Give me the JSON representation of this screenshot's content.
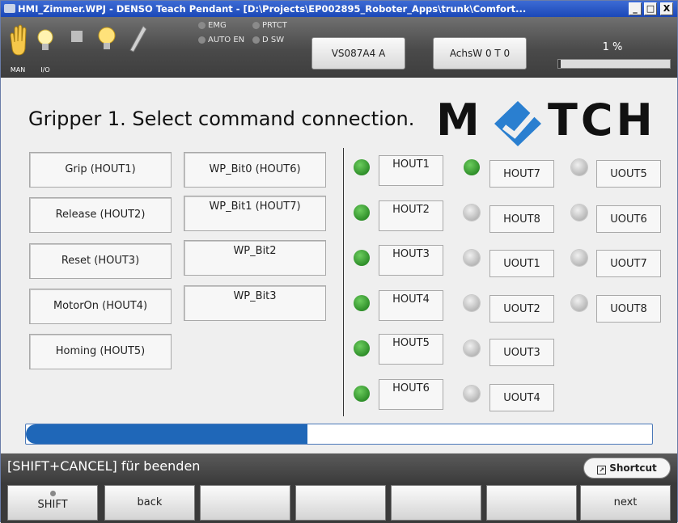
{
  "window": {
    "title": "HMI_Zimmer.WPJ - DENSO Teach Pendant - [D:\\Projects\\EP002895_Roboter_Apps\\trunk\\Comfort...",
    "min": "_",
    "max": "□",
    "close": "X"
  },
  "toolbar": {
    "mode_label": "MAN",
    "io_label": "I/O",
    "leds": {
      "emg": "EMG",
      "prtct": "PRTCT",
      "auto_en": "AUTO EN",
      "dsw": "D SW"
    },
    "field1": "VS087A4 A",
    "field2": "AchsW 0 T 0",
    "speed_text": "1 %",
    "speed_level": 0.01
  },
  "main": {
    "heading": "Gripper 1. Select command connection.",
    "logo_left": "M",
    "logo_right": "TCH",
    "commands": [
      "Grip (HOUT1)",
      "Release (HOUT2)",
      "Reset (HOUT3)",
      "MotorOn (HOUT4)",
      "Homing (HOUT5)",
      "WP_Bit0 (HOUT6)",
      "WP_Bit1 (HOUT7)",
      "WP_Bit2",
      "WP_Bit3"
    ],
    "io": [
      {
        "label": "HOUT1",
        "state": "on"
      },
      {
        "label": "HOUT2",
        "state": "on"
      },
      {
        "label": "HOUT3",
        "state": "on"
      },
      {
        "label": "HOUT4",
        "state": "on"
      },
      {
        "label": "HOUT5",
        "state": "on"
      },
      {
        "label": "HOUT6",
        "state": "on"
      },
      {
        "label": "HOUT7",
        "state": "on"
      },
      {
        "label": "HOUT8",
        "state": "off"
      },
      {
        "label": "UOUT1",
        "state": "off"
      },
      {
        "label": "UOUT2",
        "state": "off"
      },
      {
        "label": "UOUT3",
        "state": "off"
      },
      {
        "label": "UOUT4",
        "state": "off"
      },
      {
        "label": "UOUT5",
        "state": "off"
      },
      {
        "label": "UOUT6",
        "state": "off"
      },
      {
        "label": "UOUT7",
        "state": "off"
      },
      {
        "label": "UOUT8",
        "state": "off"
      }
    ],
    "progress_fraction": 0.45
  },
  "status": {
    "text": "[SHIFT+CANCEL] für beenden",
    "shortcut": "Shortcut"
  },
  "fkeys": {
    "shift": "SHIFT",
    "back": "back",
    "next": "next"
  },
  "colors": {
    "led_on": "#3fa83a",
    "led_off": "#c4c4c4",
    "progress": "#1f67b8",
    "logo_blue": "#2a7fd0"
  }
}
